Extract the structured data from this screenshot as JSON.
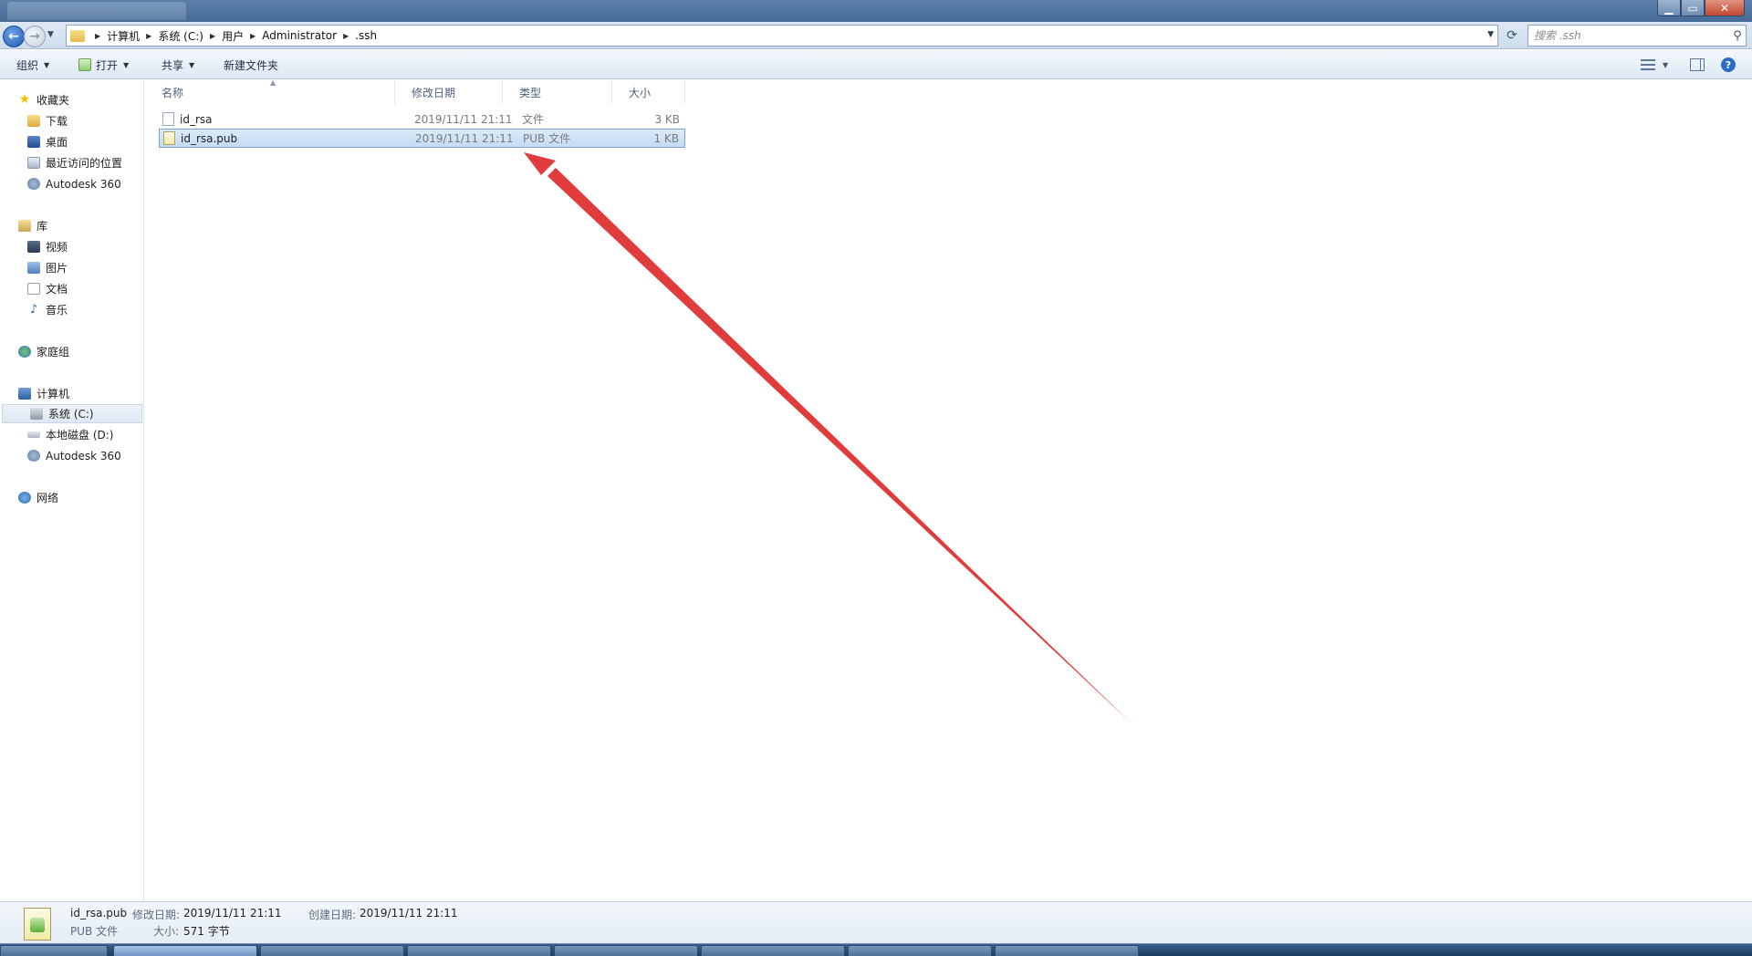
{
  "address": {
    "breadcrumb": [
      "计算机",
      "系统 (C:)",
      "用户",
      "Administrator",
      ".ssh"
    ]
  },
  "search": {
    "placeholder": "搜索 .ssh"
  },
  "toolbar": {
    "organize": "组织",
    "open": "打开",
    "share": "共享",
    "new_folder": "新建文件夹"
  },
  "sidebar": {
    "favorites": {
      "label": "收藏夹",
      "items": [
        "下载",
        "桌面",
        "最近访问的位置",
        "Autodesk 360"
      ]
    },
    "libraries": {
      "label": "库",
      "items": [
        "视频",
        "图片",
        "文档",
        "音乐"
      ]
    },
    "homegroup": {
      "label": "家庭组"
    },
    "computer": {
      "label": "计算机",
      "items": [
        "系统 (C:)",
        "本地磁盘 (D:)",
        "Autodesk 360"
      ]
    },
    "network": {
      "label": "网络"
    }
  },
  "columns": {
    "name": "名称",
    "date": "修改日期",
    "type": "类型",
    "size": "大小"
  },
  "files": [
    {
      "name": "id_rsa",
      "date": "2019/11/11 21:11",
      "type": "文件",
      "size": "3 KB",
      "selected": false
    },
    {
      "name": "id_rsa.pub",
      "date": "2019/11/11 21:11",
      "type": "PUB 文件",
      "size": "1 KB",
      "selected": true
    }
  ],
  "details": {
    "filename": "id_rsa.pub",
    "filetype": "PUB 文件",
    "modified_label": "修改日期:",
    "modified_value": "2019/11/11 21:11",
    "created_label": "创建日期:",
    "created_value": "2019/11/11 21:11",
    "size_label": "大小:",
    "size_value": "571 字节"
  },
  "annotation": {
    "arrow_color": "#e03c3c"
  }
}
